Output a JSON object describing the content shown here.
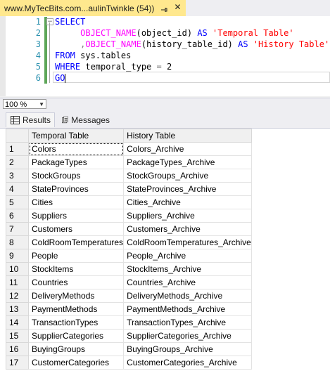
{
  "tab": {
    "title": "www.MyTecBits.com...aulinTwinkle (54))",
    "pin_icon": "pin-icon",
    "close_label": "✕"
  },
  "editor": {
    "line_numbers": [
      "1",
      "2",
      "3",
      "4",
      "5",
      "6"
    ],
    "lines": [
      {
        "segments": [
          {
            "t": "SELECT",
            "c": "kw"
          }
        ]
      },
      {
        "segments": [
          {
            "t": "     ",
            "c": ""
          },
          {
            "t": "OBJECT_NAME",
            "c": "fn"
          },
          {
            "t": "(object_id) ",
            "c": ""
          },
          {
            "t": "AS",
            "c": "kw"
          },
          {
            "t": " ",
            "c": ""
          },
          {
            "t": "'Temporal Table'",
            "c": "str"
          }
        ]
      },
      {
        "segments": [
          {
            "t": "     ",
            "c": ""
          },
          {
            "t": ",",
            "c": "gr"
          },
          {
            "t": "OBJECT_NAME",
            "c": "fn"
          },
          {
            "t": "(history_table_id) ",
            "c": ""
          },
          {
            "t": "AS",
            "c": "kw"
          },
          {
            "t": " ",
            "c": ""
          },
          {
            "t": "'History Table'",
            "c": "str"
          }
        ]
      },
      {
        "segments": [
          {
            "t": "FROM",
            "c": "kw"
          },
          {
            "t": " sys.tables",
            "c": ""
          }
        ]
      },
      {
        "segments": [
          {
            "t": "WHERE",
            "c": "kw"
          },
          {
            "t": " temporal_type ",
            "c": ""
          },
          {
            "t": "=",
            "c": "gr"
          },
          {
            "t": " 2",
            "c": ""
          }
        ]
      },
      {
        "segments": [
          {
            "t": "GO",
            "c": "kw"
          }
        ]
      }
    ]
  },
  "zoom": {
    "value": "100 %"
  },
  "results_tabs": {
    "results_label": "Results",
    "messages_label": "Messages"
  },
  "grid": {
    "columns": [
      "Temporal Table",
      "History Table"
    ],
    "rows": [
      [
        "1",
        "Colors",
        "Colors_Archive"
      ],
      [
        "2",
        "PackageTypes",
        "PackageTypes_Archive"
      ],
      [
        "3",
        "StockGroups",
        "StockGroups_Archive"
      ],
      [
        "4",
        "StateProvinces",
        "StateProvinces_Archive"
      ],
      [
        "5",
        "Cities",
        "Cities_Archive"
      ],
      [
        "6",
        "Suppliers",
        "Suppliers_Archive"
      ],
      [
        "7",
        "Customers",
        "Customers_Archive"
      ],
      [
        "8",
        "ColdRoomTemperatures",
        "ColdRoomTemperatures_Archive"
      ],
      [
        "9",
        "People",
        "People_Archive"
      ],
      [
        "10",
        "StockItems",
        "StockItems_Archive"
      ],
      [
        "11",
        "Countries",
        "Countries_Archive"
      ],
      [
        "12",
        "DeliveryMethods",
        "DeliveryMethods_Archive"
      ],
      [
        "13",
        "PaymentMethods",
        "PaymentMethods_Archive"
      ],
      [
        "14",
        "TransactionTypes",
        "TransactionTypes_Archive"
      ],
      [
        "15",
        "SupplierCategories",
        "SupplierCategories_Archive"
      ],
      [
        "16",
        "BuyingGroups",
        "BuyingGroups_Archive"
      ],
      [
        "17",
        "CustomerCategories",
        "CustomerCategories_Archive"
      ]
    ]
  }
}
